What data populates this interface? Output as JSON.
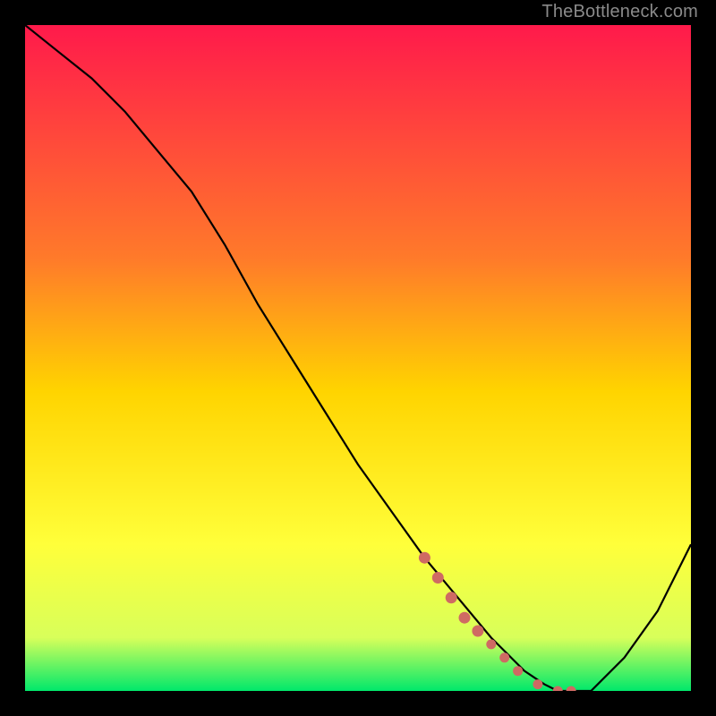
{
  "watermark": "TheBottleneck.com",
  "colors": {
    "frame": "#000000",
    "watermark": "#8a8a8a",
    "curve": "#000000",
    "dots": "#cf6a63",
    "gradient_top": "#ff1a4b",
    "gradient_mid1": "#ff7a2a",
    "gradient_mid2": "#ffd400",
    "gradient_mid3": "#ffff3a",
    "gradient_mid4": "#d8ff5a",
    "gradient_bottom": "#00e86b"
  },
  "chart_data": {
    "type": "line",
    "title": "",
    "xlabel": "",
    "ylabel": "",
    "xlim": [
      0,
      100
    ],
    "ylim": [
      0,
      100
    ],
    "grid": false,
    "legend": false,
    "series": [
      {
        "name": "bottleneck-curve",
        "x": [
          0,
          5,
          10,
          15,
          20,
          25,
          30,
          35,
          40,
          45,
          50,
          55,
          60,
          65,
          70,
          72,
          75,
          78,
          80,
          82,
          85,
          90,
          95,
          100
        ],
        "y": [
          100,
          96,
          92,
          87,
          81,
          75,
          67,
          58,
          50,
          42,
          34,
          27,
          20,
          14,
          8,
          6,
          3,
          1,
          0,
          0,
          0,
          5,
          12,
          22
        ]
      }
    ],
    "highlight_points": {
      "name": "highlight-dots",
      "x": [
        60,
        62,
        64,
        66,
        68,
        70,
        72,
        74,
        77,
        80,
        82
      ],
      "y": [
        20,
        17,
        14,
        11,
        9,
        7,
        5,
        3,
        1,
        0,
        0
      ]
    }
  }
}
